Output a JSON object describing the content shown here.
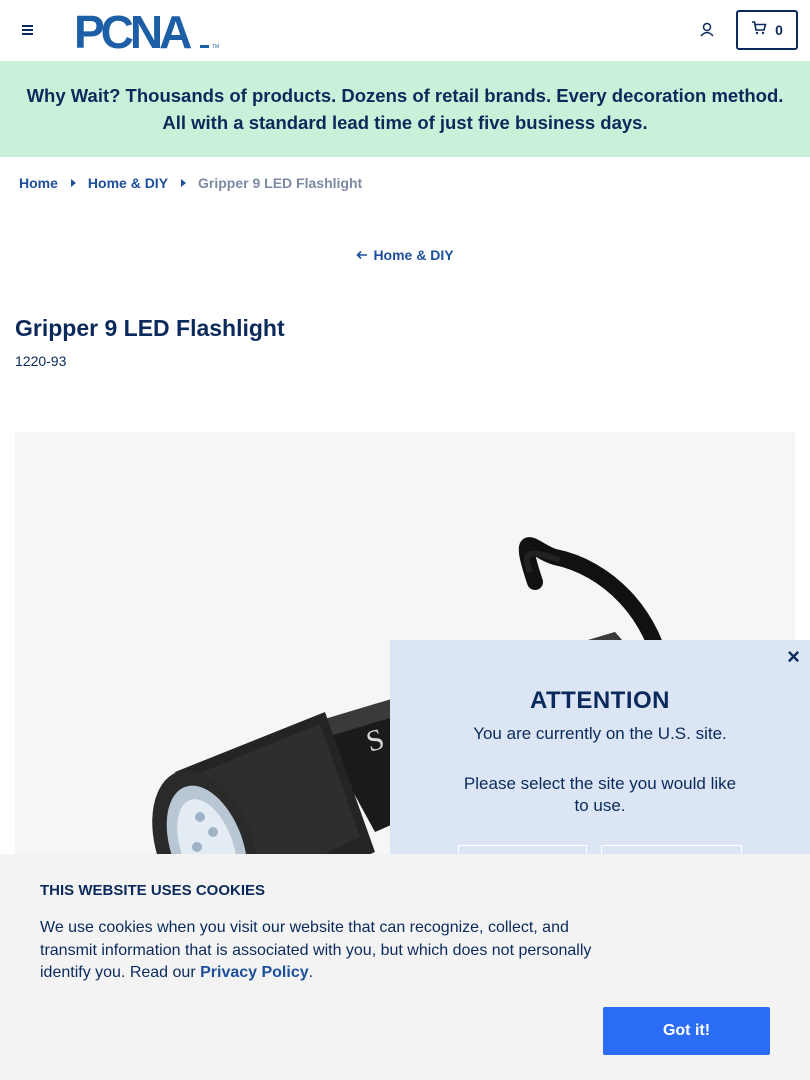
{
  "header": {
    "logo_text": "PCNA",
    "cart_count": "0"
  },
  "promo": {
    "text": "Why Wait? Thousands of products. Dozens of retail brands. Every decoration method. All with a standard lead time of just five business days."
  },
  "breadcrumb": {
    "items": [
      {
        "label": "Home"
      },
      {
        "label": "Home & DIY"
      },
      {
        "label": "Gripper 9 LED Flashlight"
      }
    ]
  },
  "back_link": {
    "label": "Home & DIY"
  },
  "product": {
    "title": "Gripper 9 LED Flashlight",
    "sku": "1220-93"
  },
  "modal": {
    "close": "×",
    "title": "ATTENTION",
    "line1": "You are currently on the U.S. site.",
    "line2": "Please select the site you would like to use."
  },
  "cookie": {
    "title": "THIS WEBSITE USES COOKIES",
    "text": "We use cookies when you visit our website that can recognize, collect, and transmit information that is associated with you, but which does not personally identify you. Read our ",
    "link": "Privacy Policy",
    "suffix": ".",
    "button": "Got it!"
  },
  "colors": {
    "navy": "#0b2a5b",
    "link_blue": "#1d4f9a",
    "promo_bg": "#c9f0d8",
    "modal_bg": "#dbe5f4",
    "cookie_btn": "#2a6df4"
  },
  "icons": [
    "menu-icon",
    "user-icon",
    "cart-icon",
    "arrow-left-icon",
    "caret-right-icon",
    "close-icon"
  ]
}
